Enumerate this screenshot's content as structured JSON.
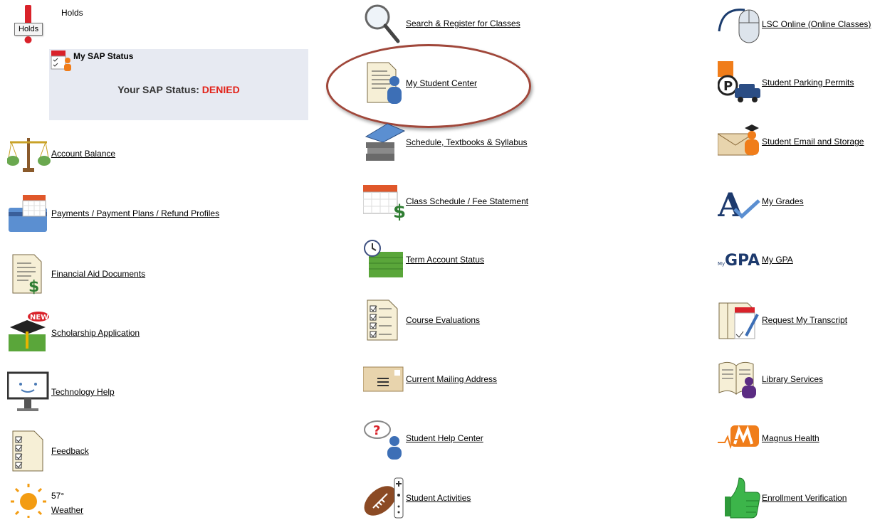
{
  "holds": {
    "label": "Holds",
    "tooltip": "Holds"
  },
  "sap": {
    "heading": "My SAP Status",
    "status_prefix": "Your SAP Status: ",
    "status_value": "DENIED"
  },
  "weather": {
    "temperature": "57°",
    "link": "Weather"
  },
  "left_links": {
    "account_balance": "Account Balance",
    "payments": "Payments / Payment Plans / Refund Profiles",
    "financial_aid": "Financial Aid Documents",
    "scholarship": "Scholarship Application",
    "technology_help": "Technology Help",
    "feedback": "Feedback",
    "new_badge": "NEW"
  },
  "middle_links": {
    "search_register": "Search & Register for Classes",
    "student_center": "My Student Center",
    "schedule_textbooks": "Schedule, Textbooks & Syllabus",
    "class_schedule": "Class Schedule / Fee Statement",
    "term_account": "Term Account Status",
    "course_evaluations": "Course Evaluations",
    "mailing_address": "Current Mailing Address",
    "help_center": "Student Help Center",
    "activities": "Student Activities"
  },
  "right_links": {
    "lsc_online": "LSC Online (Online Classes)",
    "parking": "Student Parking Permits",
    "email_storage": "Student Email and Storage",
    "my_grades": "My Grades",
    "my_gpa": "My GPA",
    "gpa_logo": "GPA",
    "transcript": "Request My Transcript",
    "library": "Library Services",
    "magnus": "Magnus Health",
    "enrollment": "Enrollment Verification"
  },
  "colors": {
    "denied": "#e2231a",
    "sap_panel": "#e7eaf2",
    "highlight_ring": "#a0473a"
  }
}
